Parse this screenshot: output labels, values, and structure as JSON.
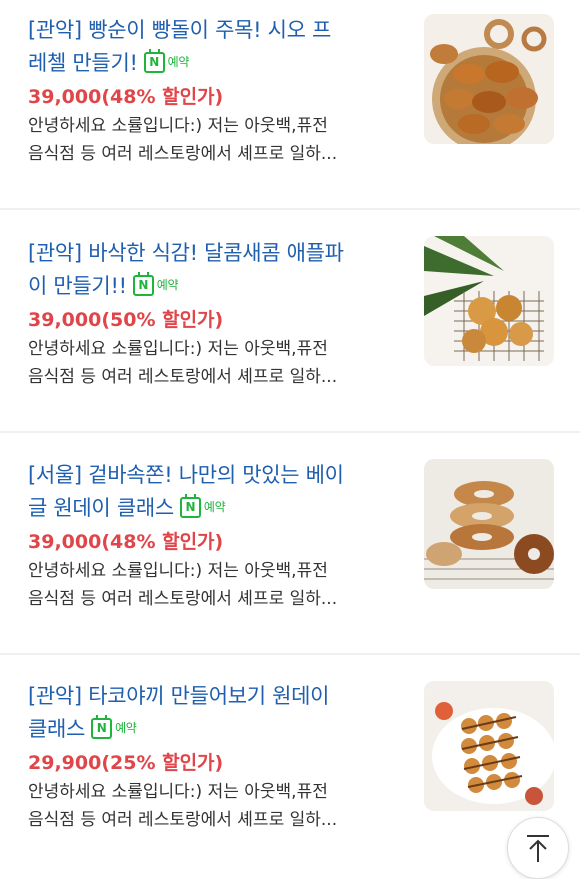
{
  "items": [
    {
      "title_line1": "[관악] 빵순이 빵돌이 주목! 시오 프",
      "title_line2": "레첼 만들기!",
      "badge": "예약",
      "price": "39,000(48% 할인가)",
      "desc_line1": "안녕하세요 소률입니다:) 저는 아웃백,퓨전",
      "desc_line2": "음식점 등 여러 레스토랑에서 셰프로 일하..."
    },
    {
      "title_line1": "[관악] 바삭한 식감! 달콤새콤 애플파",
      "title_line2": "이 만들기!!",
      "badge": "예약",
      "price": "39,000(50% 할인가)",
      "desc_line1": "안녕하세요 소률입니다:) 저는 아웃백,퓨전",
      "desc_line2": "음식점 등 여러 레스토랑에서 셰프로 일하..."
    },
    {
      "title_line1": "[서울] 겉바속쫀! 나만의 맛있는 베이",
      "title_line2": "글 원데이 클래스",
      "badge": "예약",
      "price": "39,000(48% 할인가)",
      "desc_line1": "안녕하세요 소률입니다:) 저는 아웃백,퓨전",
      "desc_line2": "음식점 등 여러 레스토랑에서 셰프로 일하..."
    },
    {
      "title_line1": "[관악] 타코야끼 만들어보기 원데이",
      "title_line2": "클래스",
      "badge": "예약",
      "price": "29,900(25% 할인가)",
      "desc_line1": "안녕하세요 소률입니다:) 저는 아웃백,퓨전",
      "desc_line2": "음식점 등 여러 레스토랑에서 셰프로 일하..."
    }
  ]
}
